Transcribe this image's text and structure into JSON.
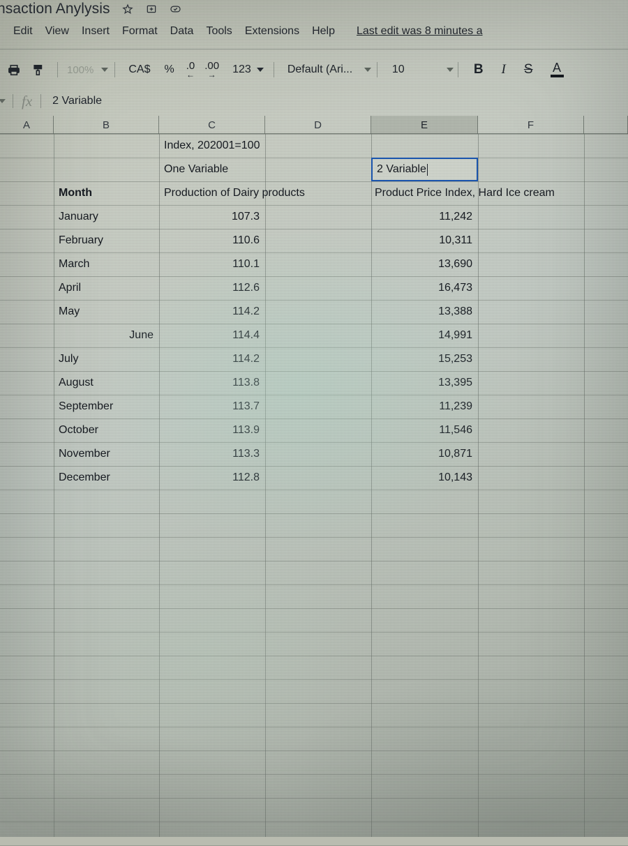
{
  "window": {
    "doc_title": "nsaction Anylysis",
    "title_icons": [
      "star-icon",
      "move-to-folder-icon",
      "saved-to-drive-icon"
    ]
  },
  "menubar": {
    "items": [
      "Edit",
      "View",
      "Insert",
      "Format",
      "Data",
      "Tools",
      "Extensions",
      "Help"
    ],
    "last_edit": "Last edit was 8 minutes a"
  },
  "toolbar": {
    "print_icon": "print-icon",
    "paint_format_icon": "paint-format-icon",
    "zoom_value": "100%",
    "currency_label": "CA$",
    "percent_label": "%",
    "decrease_decimal_label": ".0",
    "decrease_decimal_arrow": "←",
    "increase_decimal_label": ".00",
    "increase_decimal_arrow": "→",
    "number_format_label": "123",
    "font_name": "Default (Ari...",
    "font_size": "10",
    "bold_label": "B",
    "italic_label": "I",
    "strikethrough_label": "S",
    "text_color_label": "A"
  },
  "formula_bar": {
    "fx_label": "fx",
    "value": "2 Variable"
  },
  "grid": {
    "column_headers": [
      "A",
      "B",
      "C",
      "D",
      "E",
      "F"
    ],
    "selected_column": "E"
  },
  "sheet": {
    "c1": "Index, 202001=100",
    "c2": "One Variable",
    "e2": "2 Variable",
    "b3": "Month",
    "c3": "Production of Dairy products",
    "e3": "Product Price Index, Hard Ice cream",
    "rows": [
      {
        "month": "January",
        "month_align": "l",
        "production": "107.3",
        "price_index": "11,242"
      },
      {
        "month": "February",
        "month_align": "l",
        "production": "110.6",
        "price_index": "10,311"
      },
      {
        "month": "March",
        "month_align": "l",
        "production": "110.1",
        "price_index": "13,690"
      },
      {
        "month": "April",
        "month_align": "l",
        "production": "112.6",
        "price_index": "16,473"
      },
      {
        "month": "May",
        "month_align": "l",
        "production": "114.2",
        "price_index": "13,388"
      },
      {
        "month": "June",
        "month_align": "r",
        "production": "114.4",
        "price_index": "14,991"
      },
      {
        "month": "July",
        "month_align": "l",
        "production": "114.2",
        "price_index": "15,253"
      },
      {
        "month": "August",
        "month_align": "l",
        "production": "113.8",
        "price_index": "13,395"
      },
      {
        "month": "September",
        "month_align": "l",
        "production": "113.7",
        "price_index": "11,239"
      },
      {
        "month": "October",
        "month_align": "l",
        "production": "113.9",
        "price_index": "11,546"
      },
      {
        "month": "November",
        "month_align": "l",
        "production": "113.3",
        "price_index": "10,871"
      },
      {
        "month": "December",
        "month_align": "l",
        "production": "112.8",
        "price_index": "10,143"
      }
    ]
  },
  "selection": {
    "active_cell_text": "2 Variable",
    "border_color": "#1a56b0"
  }
}
